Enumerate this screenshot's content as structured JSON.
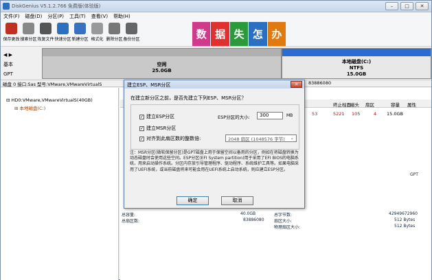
{
  "window": {
    "title": "DiskGenius V5.1.2.766 免费版(体验版)"
  },
  "menu": [
    "文件(F)",
    "磁盘(D)",
    "分区(P)",
    "工具(T)",
    "查看(V)",
    "帮助(H)"
  ],
  "toolbar": [
    {
      "label": "保存更改",
      "icon": "save-icon",
      "color": "#c03020"
    },
    {
      "label": "搜索分区",
      "icon": "search-icon",
      "color": "#888"
    },
    {
      "label": "恢复文件",
      "icon": "recover-icon",
      "color": "#555"
    },
    {
      "label": "快速分区",
      "icon": "quick-partition-icon",
      "color": "#2a6fc0"
    },
    {
      "label": "新建分区",
      "icon": "new-partition-icon",
      "color": "#3a70c0"
    },
    {
      "label": "格式化",
      "icon": "format-icon",
      "color": "#999"
    },
    {
      "label": "删除分区",
      "icon": "delete-icon",
      "color": "#777"
    },
    {
      "label": "备份分区",
      "icon": "backup-icon",
      "color": "#666"
    }
  ],
  "ad": [
    {
      "text": "数",
      "color": "#d03a8a"
    },
    {
      "text": "据",
      "color": "#e03030"
    },
    {
      "text": "失",
      "color": "#2a9a3a"
    },
    {
      "text": "怎",
      "color": "#2a6fc0"
    },
    {
      "text": "办",
      "color": "#e07a10"
    }
  ],
  "diskbar": {
    "side1": "基本",
    "side2": "GPT",
    "free_label": "空闲",
    "free_size": "25.0GB",
    "part_label": "本地磁盘(C:)",
    "part_fs": "NTFS",
    "part_size": "15.0GB"
  },
  "diskinfo": {
    "text": "磁盘 0 接口:Sas 型号:VMware,VMwareVirtualS",
    "sectors": "83886080"
  },
  "tree": {
    "disk": "HD0:VMware,VMwareVirtualS(40GB)",
    "part": "本地磁盘(C:)"
  },
  "columns": [
    "终止柱面",
    "磁头",
    "扇区",
    "容量",
    "属性"
  ],
  "row": {
    "start_sector": "53",
    "end_cyl": "5221",
    "head": "105",
    "sector": "4",
    "size": "15.0GB"
  },
  "gpt": "GPT",
  "stats": {
    "total_label": "总容量:",
    "total": "40.0GB",
    "sectors_label": "总扇区数:",
    "sectors": "83886080",
    "bytes_label": "总字节数:",
    "bytes": "42949672960",
    "sector_size_label": "扇区大小:",
    "sector_size": "512 Bytes",
    "phys_label": "物理扇区大小:",
    "phys": "512 Bytes"
  },
  "dialog": {
    "title": "建立ESP、MSR分区",
    "question": "在建立新分区之前，是否先建立下列ESP、MSR分区？",
    "esp_label": "建立ESP分区",
    "esp_size_label": "ESP分区的大小:",
    "esp_size": "300",
    "unit": "MB",
    "msr_label": "建立MSR分区",
    "align_label": "对齐到此扇区数的整数倍:",
    "align_value": "2048 扇区 (1048576 字节)",
    "note": "注：MSR分区(微软保留分区)是GPT磁盘上用于保留空间以备用的分区，例如在将磁盘转换为动态磁盘时会使用这些空间。ESP分区(EFI System partition)用于采用了EFI BIOS的电脑系统，用来启动操作系统。分区内存放引导管理程序、驱动程序、系统维护工具等。如果电脑采用了UEFI系统，或当前磁盘将来可能会用在UEFI系统上启动系统，则应建立ESP分区。",
    "ok": "确定",
    "cancel": "取消"
  }
}
